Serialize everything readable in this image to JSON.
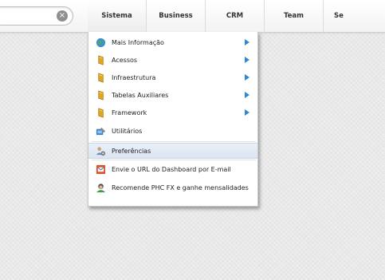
{
  "search": {
    "clear_glyph": "×"
  },
  "nav": {
    "items": [
      {
        "label": "Sistema"
      },
      {
        "label": "Business"
      },
      {
        "label": "CRM"
      },
      {
        "label": "Team"
      },
      {
        "label": "Se"
      }
    ]
  },
  "dropdown": {
    "items": [
      {
        "label": "Mais Informação",
        "icon": "globe-icon",
        "has_submenu": true
      },
      {
        "label": "Acessos",
        "icon": "folder-icon",
        "has_submenu": true
      },
      {
        "label": "Infraestrutura",
        "icon": "folder-icon",
        "has_submenu": true
      },
      {
        "label": "Tabelas Auxiliares",
        "icon": "folder-icon",
        "has_submenu": true
      },
      {
        "label": "Framework",
        "icon": "folder-icon",
        "has_submenu": true
      },
      {
        "label": "Utilitários",
        "icon": "tools-icon",
        "has_submenu": false
      },
      {
        "label": "Preferências",
        "icon": "preferences-icon",
        "has_submenu": false,
        "selected": true
      },
      {
        "label": "Envie o URL do Dashboard por E-mail",
        "icon": "email-icon",
        "has_submenu": false
      },
      {
        "label": "Recomende PHC FX e ganhe mensalidades",
        "icon": "recommend-icon",
        "has_submenu": false
      }
    ]
  },
  "colors": {
    "submenu_arrow": "#2e86d8",
    "selected_bg": "#dbe6f2"
  }
}
